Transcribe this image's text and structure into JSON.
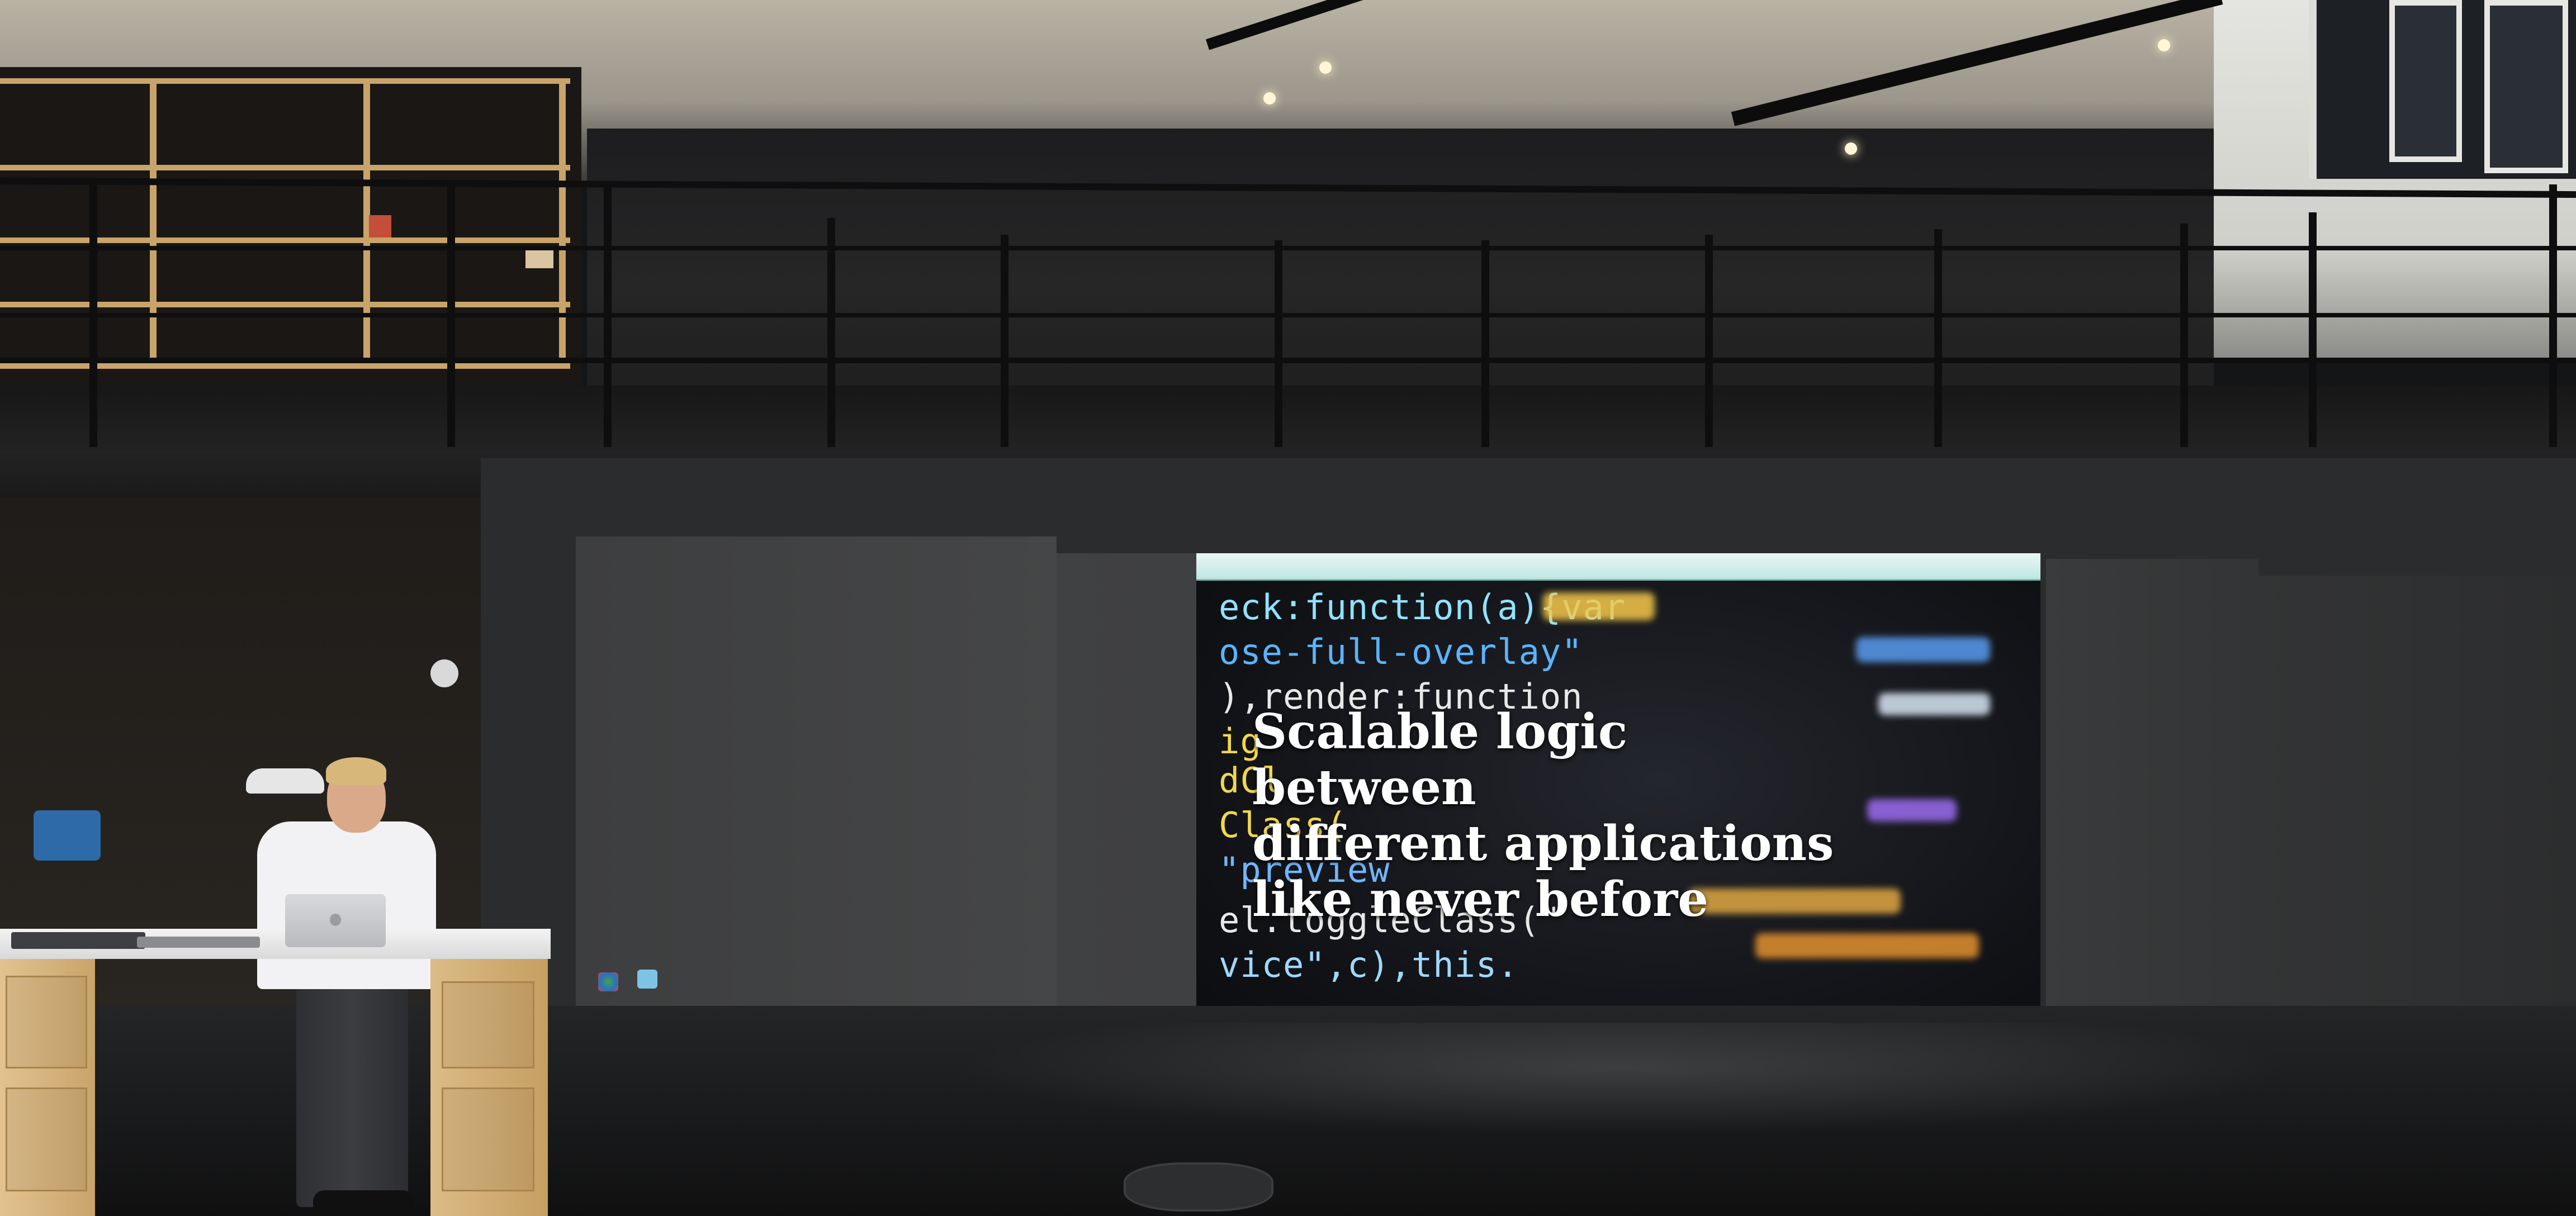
{
  "scene": {
    "type": "photograph",
    "subject": "presenter-beside-projection-wall"
  },
  "slide": {
    "caption_lines": [
      "Scalable logic between",
      "different applications",
      "like never before"
    ],
    "code_lines": [
      {
        "text": "eck:function(a){var",
        "color": "#8fe3ff"
      },
      {
        "text": "ose-full-overlay\"",
        "color": "#5ab4ff"
      },
      {
        "text": "),render:function",
        "color": "#e8e8e8"
      },
      {
        "text": "ig",
        "color": "#f2d84a"
      },
      {
        "text": "dCl",
        "color": "#f2d84a"
      },
      {
        "text": "Class(",
        "color": "#f2d84a"
      },
      {
        "text": "\"preview",
        "color": "#6fb6ff"
      },
      {
        "text": "el.toggleClass(\"",
        "color": "#e8e8e8"
      },
      {
        "text": "vice\",c),this.",
        "color": "#9fd8ff"
      }
    ]
  },
  "colors": {
    "caption_text": "#ffffff",
    "browser_bar": "#bfe7e2",
    "desk_wood": "#c9a46a",
    "shirt": "#f2f2f4"
  }
}
